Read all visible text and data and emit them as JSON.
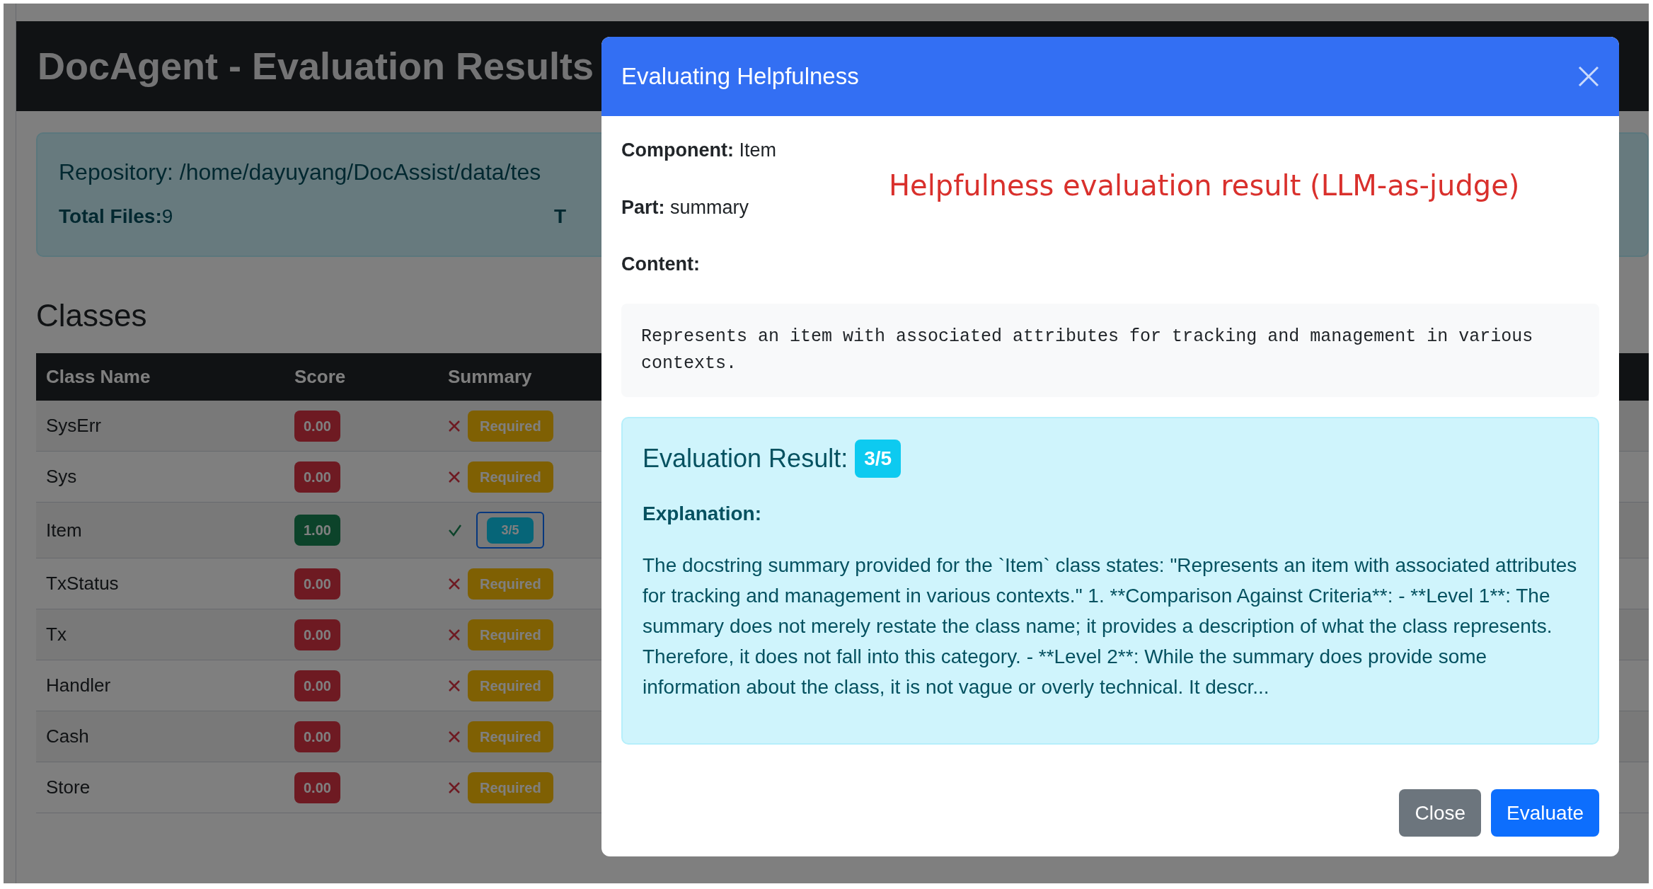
{
  "page": {
    "title": "DocAgent - Evaluation Results",
    "repository": {
      "label": "Repository:",
      "value": " /home/dayuyang/DocAssist/data/tes"
    },
    "stats": [
      {
        "label": "Total Files:",
        "value": "9"
      },
      {
        "label": "T"
      }
    ],
    "section_title": "Classes",
    "table": {
      "columns": [
        "Class Name",
        "Score",
        "Summary"
      ],
      "rows": [
        {
          "name": "SysErr",
          "score": "0.00",
          "passed": false,
          "summary": {
            "kind": "badge",
            "text": "Required"
          }
        },
        {
          "name": "Sys",
          "score": "0.00",
          "passed": false,
          "summary": {
            "kind": "badge",
            "text": "Required"
          }
        },
        {
          "name": "Item",
          "score": "1.00",
          "passed": true,
          "summary": {
            "kind": "button",
            "text": "3/5"
          }
        },
        {
          "name": "TxStatus",
          "score": "0.00",
          "passed": false,
          "summary": {
            "kind": "badge",
            "text": "Required"
          }
        },
        {
          "name": "Tx",
          "score": "0.00",
          "passed": false,
          "summary": {
            "kind": "badge",
            "text": "Required"
          }
        },
        {
          "name": "Handler",
          "score": "0.00",
          "passed": false,
          "summary": {
            "kind": "badge",
            "text": "Required"
          }
        },
        {
          "name": "Cash",
          "score": "0.00",
          "passed": false,
          "summary": {
            "kind": "badge",
            "text": "Required"
          }
        },
        {
          "name": "Store",
          "score": "0.00",
          "passed": false,
          "summary": {
            "kind": "badge",
            "text": "Required"
          }
        }
      ]
    }
  },
  "modal": {
    "title": "Evaluating Helpfulness",
    "fields": [
      {
        "label": "Component:",
        "value": " Item"
      },
      {
        "label": "Part:",
        "value": " summary"
      },
      {
        "label": "Content:"
      }
    ],
    "content": "Represents an item with associated attributes for tracking and management in various contexts.",
    "annotation": "Helpfulness evaluation result (LLM-as-judge)",
    "result": {
      "label": "Evaluation Result:",
      "score": "3/5",
      "explanation_label": "Explanation:",
      "explanation": "The docstring summary provided for the `Item` class states: \"Represents an item with associated attributes for tracking and management in various contexts.\" 1. **Comparison Against Criteria**: - **Level 1**: The summary does not merely restate the class name; it provides a description of what the class represents. Therefore, it does not fall into this category. - **Level 2**: While the summary does provide some information about the class, it is not vague or overly technical. It descr..."
    },
    "buttons": [
      {
        "kind": "secondary",
        "label": "Close"
      },
      {
        "kind": "primary",
        "label": "Evaluate"
      }
    ]
  }
}
